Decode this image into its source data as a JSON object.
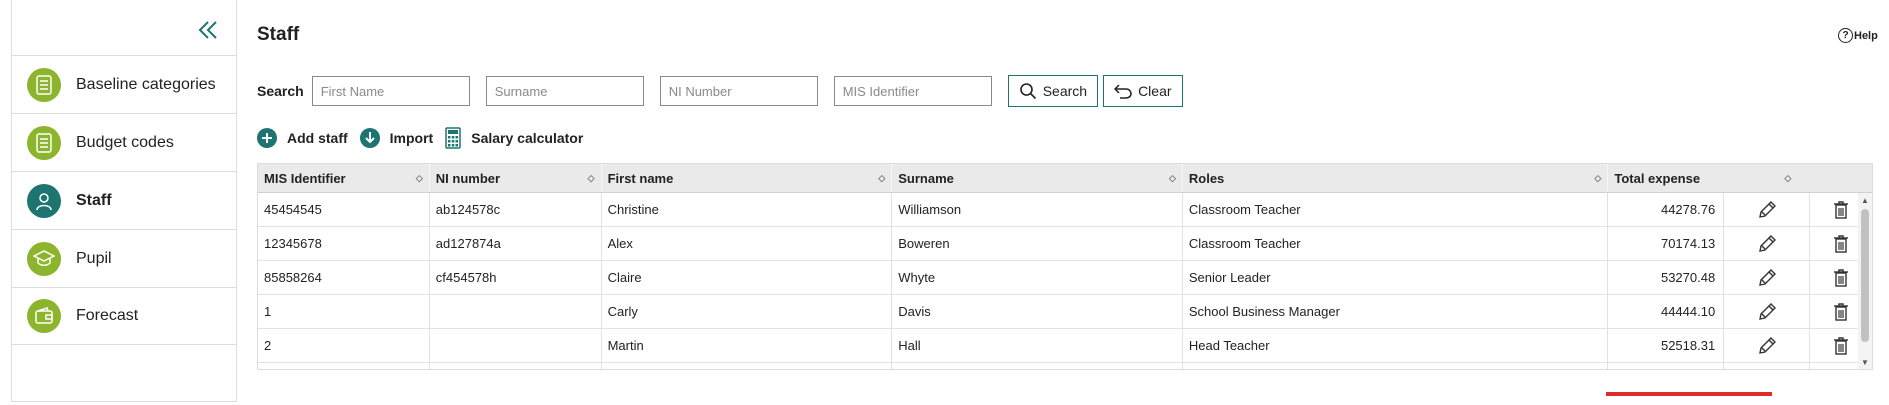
{
  "sidebar": {
    "items": [
      {
        "label": "Baseline categories",
        "icon": "list-doc-icon",
        "active": false
      },
      {
        "label": "Budget codes",
        "icon": "list-doc-icon",
        "active": false
      },
      {
        "label": "Staff",
        "icon": "user-icon",
        "active": true
      },
      {
        "label": "Pupil",
        "icon": "graduation-cap-icon",
        "active": false
      },
      {
        "label": "Forecast",
        "icon": "wallet-icon",
        "active": false
      }
    ]
  },
  "page": {
    "title": "Staff",
    "help_label": "Help"
  },
  "search": {
    "label": "Search",
    "first_name_placeholder": "First Name",
    "surname_placeholder": "Surname",
    "ni_placeholder": "NI Number",
    "mis_placeholder": "MIS Identifier",
    "search_button": "Search",
    "clear_button": "Clear"
  },
  "actions": {
    "add_staff": "Add staff",
    "import": "Import",
    "salary_calculator": "Salary calculator"
  },
  "table": {
    "headers": [
      "MIS Identifier",
      "NI number",
      "First name",
      "Surname",
      "Roles",
      "Total expense"
    ],
    "rows": [
      [
        "45454545",
        "ab124578c",
        "Christine",
        "Williamson",
        "Classroom Teacher",
        "44278.76"
      ],
      [
        "12345678",
        "ad127874a",
        "Alex",
        "Boweren",
        "Classroom Teacher",
        "70174.13"
      ],
      [
        "85858264",
        "cf454578h",
        "Claire",
        "Whyte",
        "Senior Leader",
        "53270.48"
      ],
      [
        "1",
        "",
        "Carly",
        "Davis",
        "School Business Manager",
        "44444.10"
      ],
      [
        "2",
        "",
        "Martin",
        "Hall",
        "Head Teacher",
        "52518.31"
      ]
    ]
  },
  "colors": {
    "accent": "#1e7470",
    "nav_icon_green": "#8db42d",
    "annotation_red": "#e02b2b"
  }
}
